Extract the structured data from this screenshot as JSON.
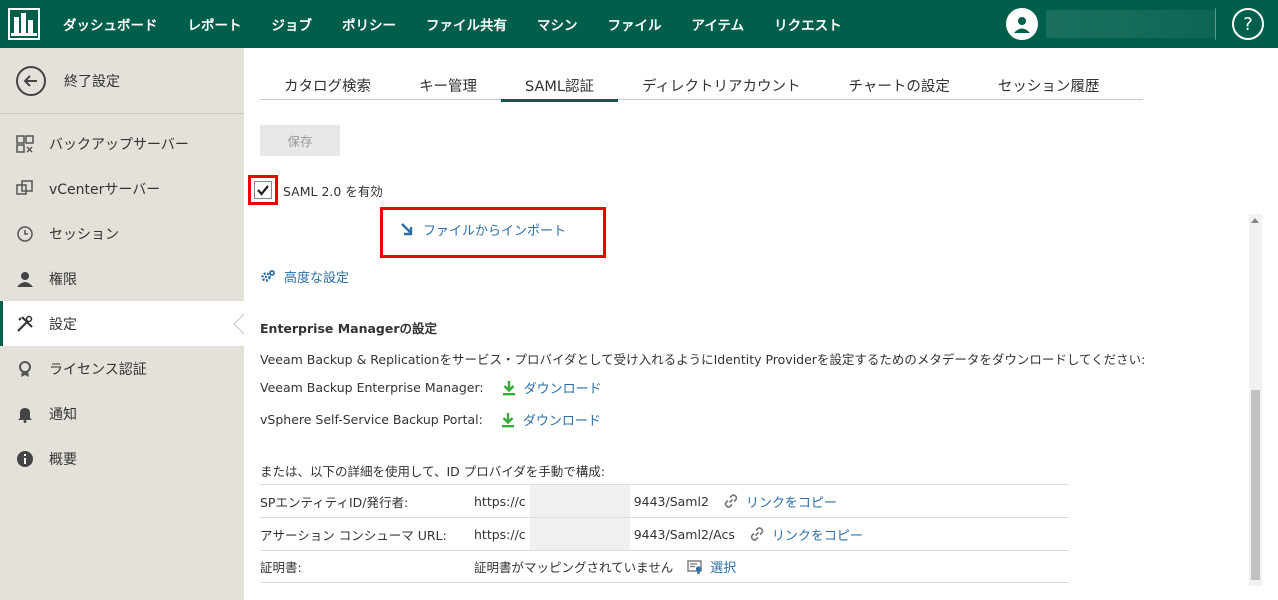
{
  "nav": {
    "items": [
      "ダッシュボード",
      "レポート",
      "ジョブ",
      "ポリシー",
      "ファイル共有",
      "マシン",
      "ファイル",
      "アイテム",
      "リクエスト"
    ],
    "help": "?"
  },
  "sidebar": {
    "back_label": "終了設定",
    "items": [
      {
        "label": "バックアップサーバー",
        "icon": "backup-server-icon"
      },
      {
        "label": "vCenterサーバー",
        "icon": "vcenter-icon"
      },
      {
        "label": "セッション",
        "icon": "clock-icon"
      },
      {
        "label": "権限",
        "icon": "user-icon"
      },
      {
        "label": "設定",
        "icon": "tools-icon"
      },
      {
        "label": "ライセンス認証",
        "icon": "license-icon"
      },
      {
        "label": "通知",
        "icon": "bell-icon"
      },
      {
        "label": "概要",
        "icon": "info-icon"
      }
    ],
    "active_index": 4
  },
  "tabs": {
    "items": [
      "カタログ検索",
      "キー管理",
      "SAML認証",
      "ディレクトリアカウント",
      "チャートの設定",
      "セッション履歴"
    ],
    "active_index": 2
  },
  "toolbar": {
    "save_label": "保存"
  },
  "saml": {
    "enable_label": "SAML 2.0 を有効",
    "enabled": true,
    "import_label": "ファイルからインポート",
    "advanced_label": "高度な設定"
  },
  "enterprise": {
    "title": "Enterprise Managerの設定",
    "description": "Veeam Backup & Replicationをサービス・プロバイダとして受け入れるようにIdentity Providerを設定するためのメタデータをダウンロードしてください:",
    "downloads": [
      {
        "label": "Veeam Backup Enterprise Manager:",
        "link": "ダウンロード"
      },
      {
        "label": "vSphere Self-Service Backup Portal:",
        "link": "ダウンロード"
      }
    ],
    "manual_label": "または、以下の詳細を使用して、ID プロバイダを手動で構成:",
    "rows": [
      {
        "key": "SPエンティティID/発行者:",
        "prefix": "https://c",
        "suffix": "9443/Saml2",
        "action": "リンクをコピー"
      },
      {
        "key": "アサーション コンシューマ URL:",
        "prefix": "https://c",
        "suffix": "9443/Saml2/Acs",
        "action": "リンクをコピー"
      },
      {
        "key": "証明書:",
        "value": "証明書がマッピングされていません",
        "action": "選択"
      }
    ]
  },
  "colors": {
    "brand": "#005f4b",
    "link": "#2e6fa8",
    "highlight": "#e00000",
    "download_icon": "#3aa93a"
  }
}
